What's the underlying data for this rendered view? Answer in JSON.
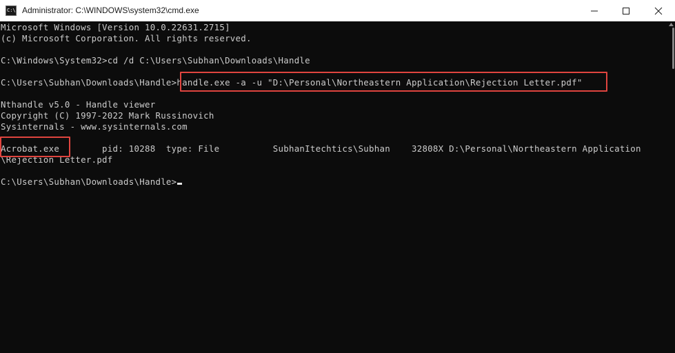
{
  "window": {
    "title": "Administrator: C:\\WINDOWS\\system32\\cmd.exe",
    "icon": "cmd-icon",
    "icon_text": "C:\\."
  },
  "controls": {
    "minimize_icon": "minimize-icon",
    "maximize_icon": "maximize-icon",
    "close_icon": "close-icon"
  },
  "console": {
    "lines": [
      "Microsoft Windows [Version 10.0.22631.2715]",
      "(c) Microsoft Corporation. All rights reserved.",
      "",
      "C:\\Windows\\System32>cd /d C:\\Users\\Subhan\\Downloads\\Handle",
      "",
      "C:\\Users\\Subhan\\Downloads\\Handle>handle.exe -a -u \"D:\\Personal\\Northeastern Application\\Rejection Letter.pdf\"",
      "",
      "Nthandle v5.0 - Handle viewer",
      "Copyright (C) 1997-2022 Mark Russinovich",
      "Sysinternals - www.sysinternals.com",
      "",
      "Acrobat.exe        pid: 10288  type: File          SubhanItechtics\\Subhan    32808X D:\\Personal\\Northeastern Application",
      "\\Rejection Letter.pdf",
      "",
      "C:\\Users\\Subhan\\Downloads\\Handle>"
    ]
  },
  "colors": {
    "background": "#0c0c0c",
    "text": "#cccccc",
    "highlight": "#e0453f"
  }
}
